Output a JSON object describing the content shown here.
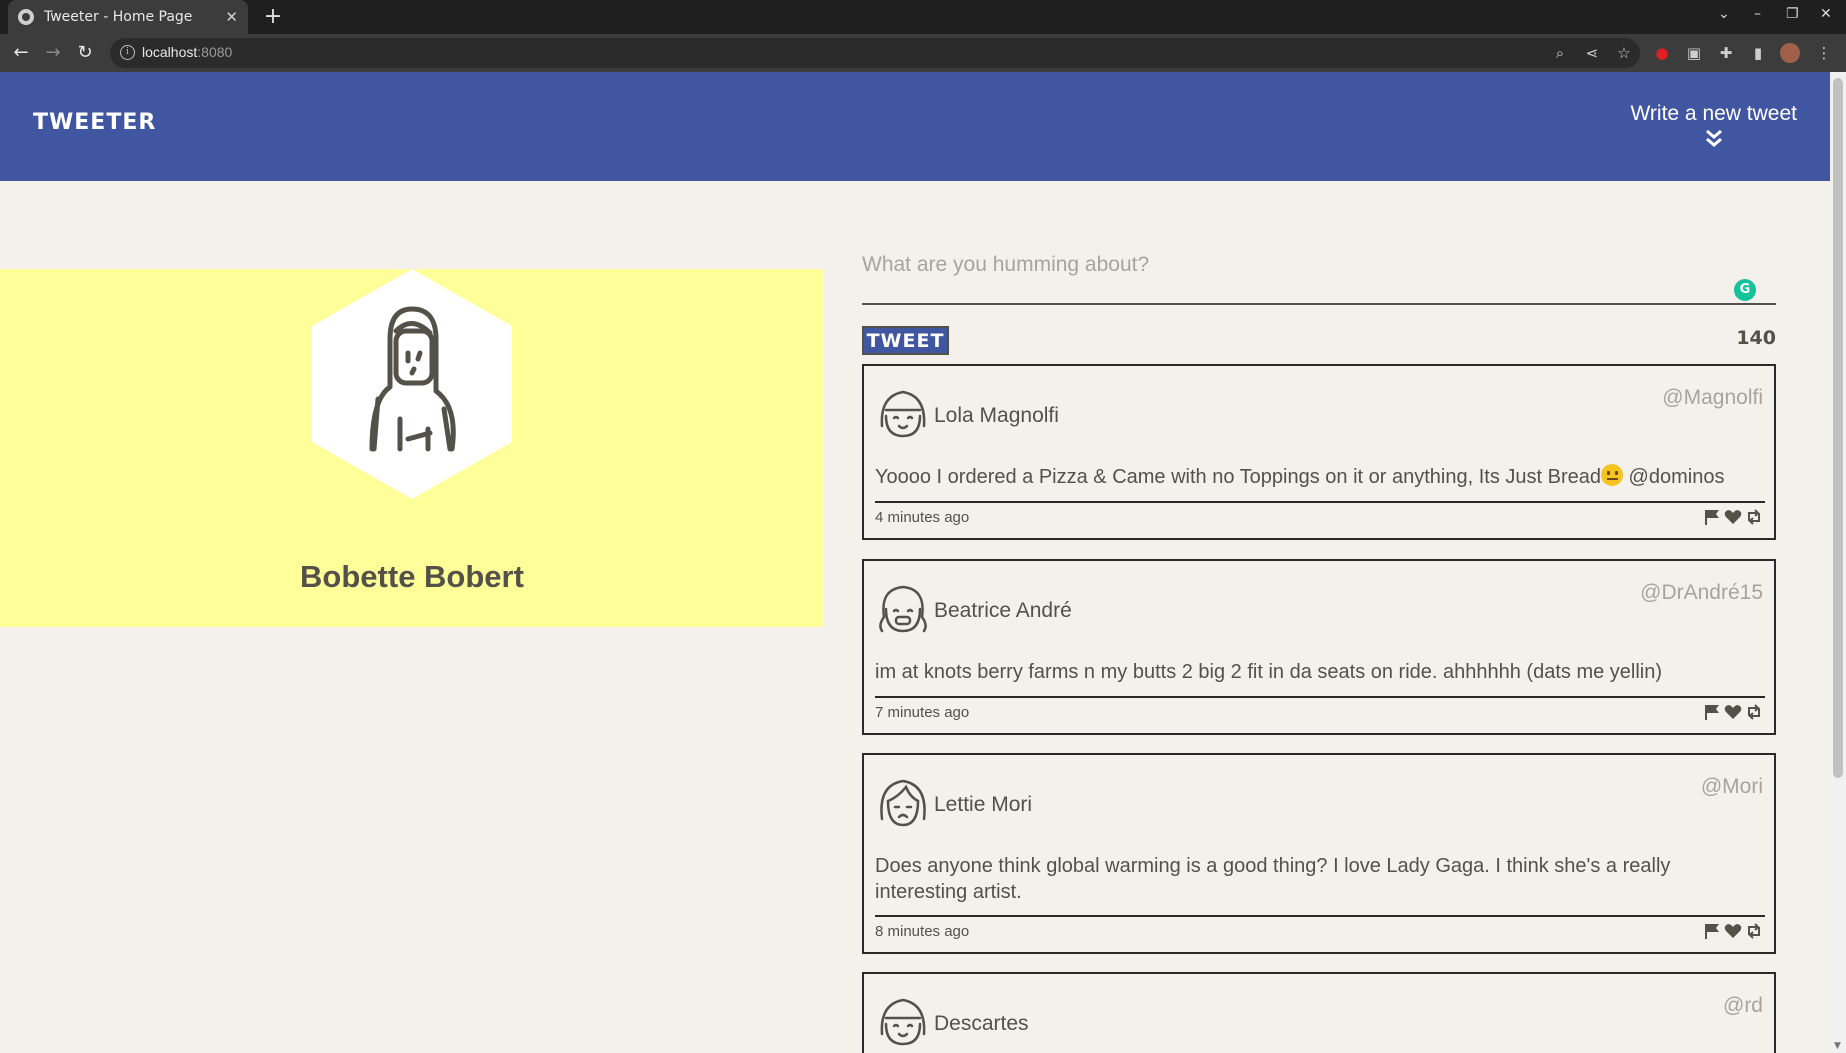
{
  "browser": {
    "tab_title": "Tweeter - Home Page",
    "url_host": "localhost",
    "url_port": ":8080"
  },
  "nav": {
    "brand": "TWEETER",
    "compose_link": "Write a new tweet"
  },
  "profile": {
    "name": "Bobette Bobert"
  },
  "compose": {
    "placeholder": "What are you humming about?",
    "button_label": "TWEET",
    "counter": "140"
  },
  "tweets": [
    {
      "name": "Lola Magnolfi",
      "handle": "@Magnolfi",
      "content_before": "Yoooo I ordered a Pizza & Came with no Toppings on it or anything, Its Just Bread",
      "content_after": " @dominos",
      "time": "4 minutes ago"
    },
    {
      "name": "Beatrice André",
      "handle": "@DrAndré15",
      "content": "im at knots berry farms n my butts 2 big 2 fit in da seats on ride. ahhhhhh (dats me yellin)",
      "time": "7 minutes ago"
    },
    {
      "name": "Lettie Mori",
      "handle": "@Mori",
      "content": "Does anyone think global warming is a good thing? I love Lady Gaga. I think she's a really interesting artist.",
      "time": "8 minutes ago"
    },
    {
      "name": "Descartes",
      "handle": "@rd"
    }
  ],
  "colors": {
    "nav_bg": "#4056a1",
    "page_bg": "#f4f1ec",
    "profile_bg": "#ffff99",
    "text": "#545149"
  }
}
